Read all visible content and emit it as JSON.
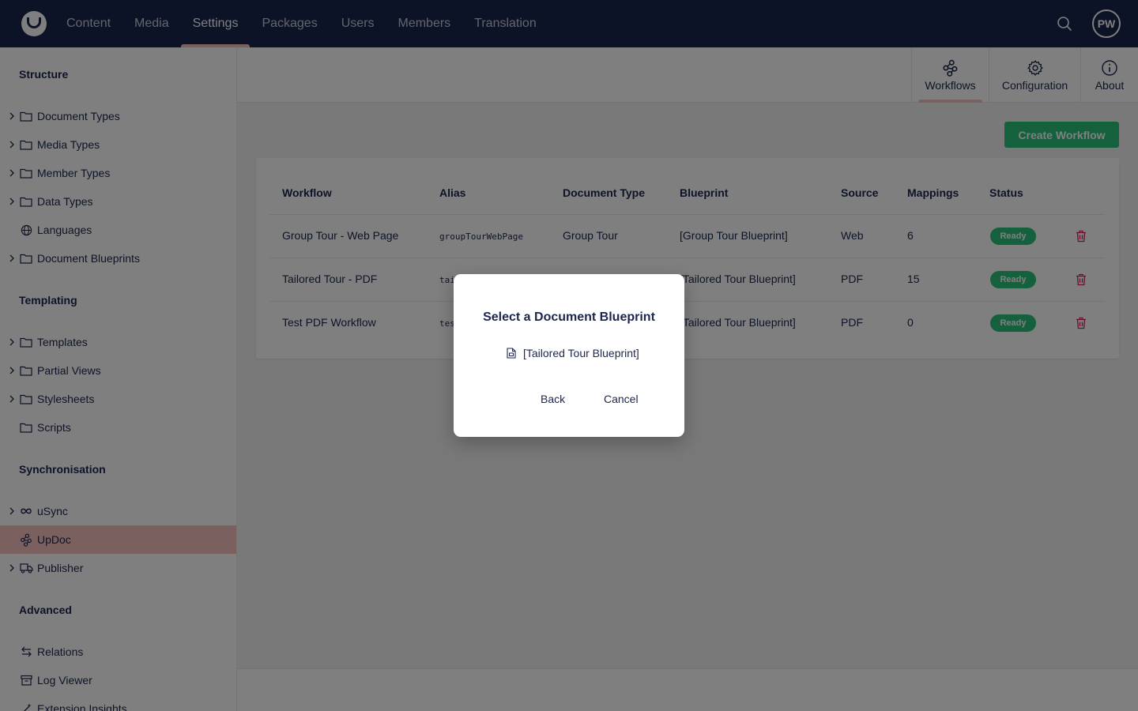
{
  "topnav": {
    "items": [
      {
        "label": "Content"
      },
      {
        "label": "Media"
      },
      {
        "label": "Settings"
      },
      {
        "label": "Packages"
      },
      {
        "label": "Users"
      },
      {
        "label": "Members"
      },
      {
        "label": "Translation"
      }
    ],
    "active": "Settings",
    "avatar_initials": "PW"
  },
  "sidebar": {
    "sections": [
      {
        "title": "Structure"
      },
      {
        "title": "Templating"
      },
      {
        "title": "Synchronisation"
      },
      {
        "title": "Advanced"
      }
    ],
    "items": [
      {
        "label": "Document Types",
        "icon": "folder-icon"
      },
      {
        "label": "Media Types",
        "icon": "folder-icon"
      },
      {
        "label": "Member Types",
        "icon": "folder-icon"
      },
      {
        "label": "Data Types",
        "icon": "folder-icon"
      },
      {
        "label": "Languages",
        "icon": "globe-icon"
      },
      {
        "label": "Document Blueprints",
        "icon": "folder-icon"
      },
      {
        "label": "Templates",
        "icon": "folder-icon"
      },
      {
        "label": "Partial Views",
        "icon": "folder-icon"
      },
      {
        "label": "Stylesheets",
        "icon": "folder-icon"
      },
      {
        "label": "Scripts",
        "icon": "folder-icon"
      },
      {
        "label": "uSync",
        "icon": "infinity-icon"
      },
      {
        "label": "UpDoc",
        "icon": "workflow-icon"
      },
      {
        "label": "Publisher",
        "icon": "truck-icon"
      },
      {
        "label": "Relations",
        "icon": "arrows-icon"
      },
      {
        "label": "Log Viewer",
        "icon": "archive-icon"
      },
      {
        "label": "Extension Insights",
        "icon": "wand-icon"
      }
    ],
    "active": "UpDoc"
  },
  "app_tabs": [
    {
      "label": "Workflows",
      "icon": "workflow-icon"
    },
    {
      "label": "Configuration",
      "icon": "gear-icon"
    },
    {
      "label": "About",
      "icon": "info-icon"
    }
  ],
  "create_button": "Create Workflow",
  "table": {
    "headers": [
      "Workflow",
      "Alias",
      "Document Type",
      "Blueprint",
      "Source",
      "Mappings",
      "Status"
    ],
    "rows": [
      {
        "workflow": "Group Tour - Web Page",
        "alias": "groupTourWebPage",
        "document_type": "Group Tour",
        "blueprint": "[Group Tour Blueprint]",
        "source": "Web",
        "mappings": "6",
        "status": "Ready"
      },
      {
        "workflow": "Tailored Tour - PDF",
        "alias": "tai",
        "document_type": "",
        "blueprint": "[Tailored Tour Blueprint]",
        "source": "PDF",
        "mappings": "15",
        "status": "Ready"
      },
      {
        "workflow": "Test PDF Workflow",
        "alias": "tes",
        "document_type": "",
        "blueprint": "[Tailored Tour Blueprint]",
        "source": "PDF",
        "mappings": "0",
        "status": "Ready"
      }
    ]
  },
  "modal": {
    "title": "Select a Document Blueprint",
    "option": "[Tailored Tour Blueprint]",
    "back": "Back",
    "cancel": "Cancel"
  },
  "colors": {
    "header_bg": "#1b264f",
    "accent_pink": "#f5c1bc",
    "positive_green": "#2bc37c",
    "danger_red": "#d42054"
  }
}
